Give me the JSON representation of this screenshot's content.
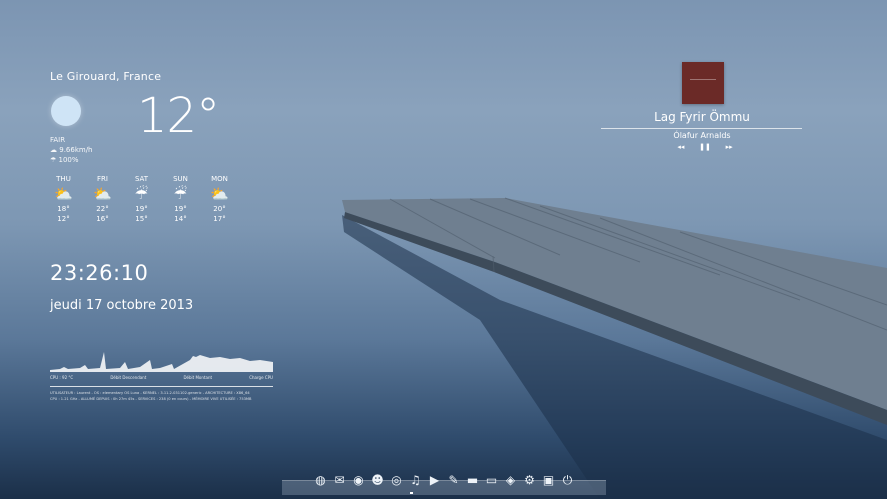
{
  "weather": {
    "location": "Le Girouard, France",
    "temperature": "12°",
    "condition": "FAIR",
    "wind": "9.66km/h",
    "humidity": "100%",
    "forecast": [
      {
        "day": "THU",
        "icon": "partly-cloudy-icon",
        "high": "18°",
        "low": "12°"
      },
      {
        "day": "FRI",
        "icon": "partly-cloudy-icon",
        "high": "22°",
        "low": "16°"
      },
      {
        "day": "SAT",
        "icon": "rain-icon",
        "high": "19°",
        "low": "15°"
      },
      {
        "day": "SUN",
        "icon": "rain-icon",
        "high": "19°",
        "low": "14°"
      },
      {
        "day": "MON",
        "icon": "partly-cloudy-icon",
        "high": "20°",
        "low": "17°"
      }
    ]
  },
  "clock": {
    "time": "23:26:10",
    "date": "jeudi 17 octobre 2013"
  },
  "system": {
    "labels": [
      "CPU : 92 °C",
      "Débit Descendant",
      "Débit Montant",
      "Charge CPU"
    ],
    "line1": "UTILISATEUR : Laurent - OS : elementary OS Luna - KERNEL : 3.11.2-031102-generic - ARCHITECTURE : X86_64",
    "line2": "CPU : 1.21 GHz - ALLUMÉ DEPUIS : 0h 27m 45s - SERVICES : 238 (0 en cours) - MÉMOIRE VIVE UTILISÉE : 753MB"
  },
  "music": {
    "track": "Lag Fyrir Ömmu",
    "artist": "Ólafur Arnalds",
    "controls": {
      "prev": "◂◂",
      "pause": "❚❚",
      "next": "▸▸"
    }
  },
  "dock": {
    "icons": [
      "globe-icon",
      "mail-icon",
      "spotify-icon",
      "contacts-icon",
      "settings-disc-icon",
      "music-icon",
      "video-icon",
      "edit-icon",
      "folder-icon",
      "scanner-icon",
      "package-icon",
      "gears-icon",
      "terminal-icon",
      "power-icon"
    ]
  }
}
